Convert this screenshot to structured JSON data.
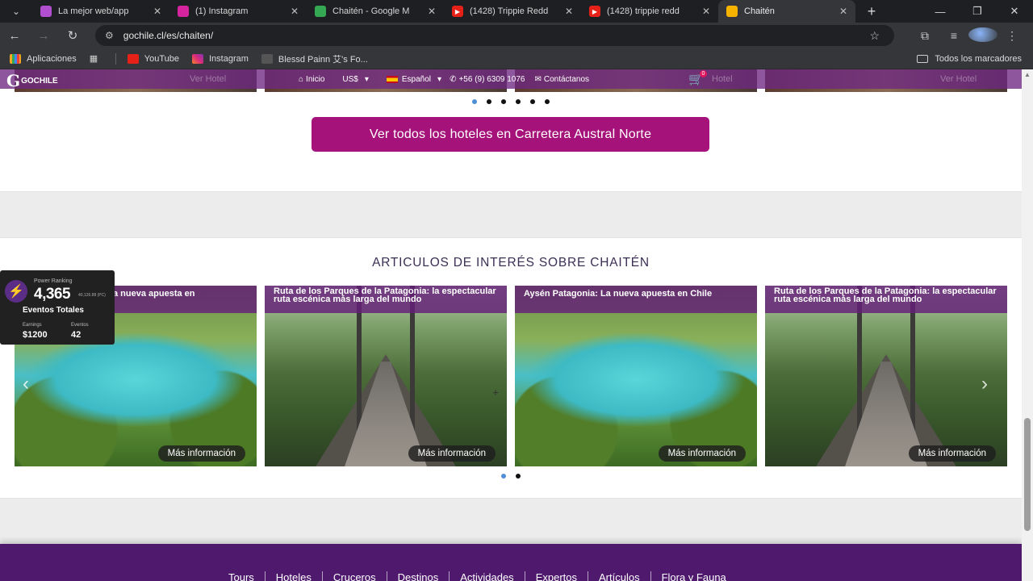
{
  "browser": {
    "tabs": [
      {
        "title": "La mejor web/app",
        "favicon_color": "#b24fd1",
        "active": false
      },
      {
        "title": "(1) Instagram",
        "favicon_color": "#d6249f",
        "active": false
      },
      {
        "title": "Chaitén - Google M",
        "favicon_color": "#34a853",
        "active": false
      },
      {
        "title": "(1428) Trippie Redd",
        "favicon_color": "#e62117",
        "active": false
      },
      {
        "title": "(1428) trippie redd",
        "favicon_color": "#e62117",
        "active": false
      },
      {
        "title": "Chaitén",
        "favicon_color": "#f6b400",
        "active": true
      }
    ],
    "new_tab": "+",
    "url": "gochile.cl/es/chaiten/",
    "bookmarks": [
      {
        "label": "Aplicaciones",
        "icon": "apps-grid-icon"
      },
      {
        "label": "YouTube",
        "icon": "youtube-icon"
      },
      {
        "label": "Instagram",
        "icon": "instagram-icon"
      },
      {
        "label": "Blessd Painn 艾's Fo...",
        "icon": "bookmark-icon"
      }
    ],
    "all_bookmarks": "Todos los marcadores"
  },
  "site": {
    "logo_text": "GOCHILE",
    "menu": {
      "home": "Inicio",
      "currency": "US$",
      "language": "Español",
      "phone": "+56 (9) 6309 1076",
      "contact": "Contáctanos",
      "cart_count": "0"
    },
    "ghost_buttons": [
      "Ver Hotel",
      "Hotel",
      "Ver Hotel"
    ],
    "cta": "Ver todos los hoteles en Carretera Austral Norte",
    "articles_title": "ARTICULOS DE INTERÉS SOBRE CHAITÉN",
    "articles": [
      {
        "title": "Aysén Patagonia: La nueva apuesta en Chile",
        "visible_title": "a nueva apuesta en",
        "more": "Más información",
        "image": "lake"
      },
      {
        "title": "Ruta de los Parques de la Patagonia: la espectacular ruta escénica más larga del mundo",
        "more": "Más información",
        "image": "bridge"
      },
      {
        "title": "Aysén Patagonia: La nueva apuesta en Chile",
        "more": "Más información",
        "image": "lake"
      },
      {
        "title": "Ruta de los Parques de la Patagonia: la espectacular ruta escénica más larga del mundo",
        "more": "Más información",
        "image": "bridge"
      }
    ],
    "footer_nav": [
      "Tours",
      "Hoteles",
      "Cruceros",
      "Destinos",
      "Actividades",
      "Expertos",
      "Artículos",
      "Flora y Fauna"
    ]
  },
  "widget": {
    "label": "Power Ranking",
    "score": "4,365",
    "small": "40,126.88 (PC)",
    "events_title": "Eventos Totales",
    "earnings_label": "Earnings",
    "earnings_value": "$1200",
    "events_label": "Eventos",
    "events_value": "42"
  },
  "colors": {
    "brand_purple": "#6e2882",
    "cta_magenta": "#a5137a",
    "footer_purple": "#4f1a6e",
    "dot_active": "#4f8fd6"
  }
}
